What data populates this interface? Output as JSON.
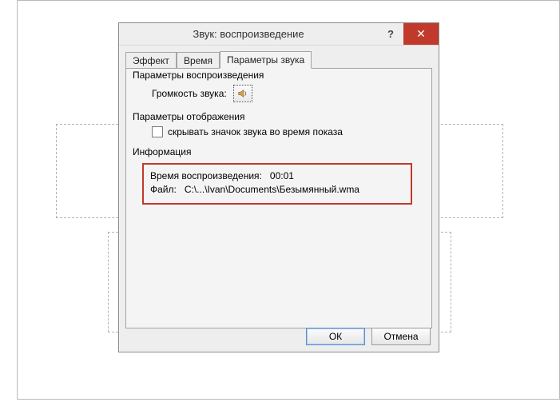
{
  "dialog": {
    "title": "Звук: воспроизведение",
    "help_symbol": "?",
    "close_symbol": "✕"
  },
  "tabs": [
    {
      "label": "Эффект"
    },
    {
      "label": "Время"
    },
    {
      "label": "Параметры звука"
    }
  ],
  "group_playback": {
    "legend": "Параметры воспроизведения",
    "volume_label": "Громкость звука:"
  },
  "group_display": {
    "legend": "Параметры отображения",
    "checkbox_label": "скрывать значок звука во время показа"
  },
  "group_info": {
    "legend": "Информация",
    "line_duration_label": "Время воспроизведения:",
    "line_duration_value": "00:01",
    "line_file_label": "Файл:",
    "line_file_value": "C:\\...\\Ivan\\Documents\\Безымянный.wma"
  },
  "buttons": {
    "ok": "ОК",
    "cancel": "Отмена"
  },
  "icons": {
    "speaker": "speaker-icon"
  },
  "colors": {
    "accent_red": "#c0392b"
  }
}
